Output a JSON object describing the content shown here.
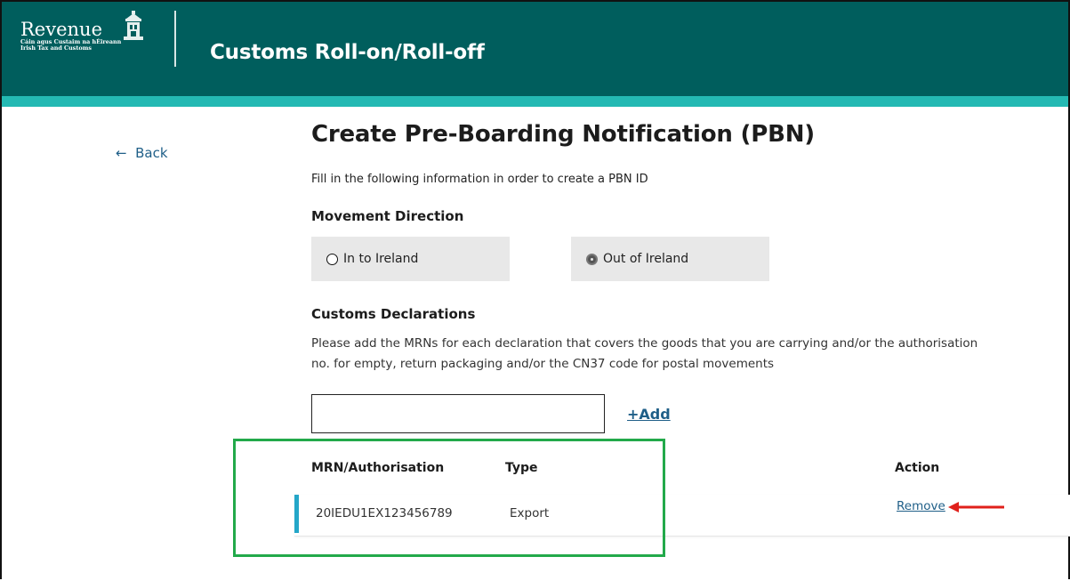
{
  "header": {
    "logo_word": "Revenue",
    "logo_line1": "Cáin agus Custaim na hÉireann",
    "logo_line2": "Irish Tax and Customs",
    "app_title": "Customs Roll-on/Roll-off"
  },
  "nav": {
    "back_icon": "arrow-left-icon",
    "back_label": "Back"
  },
  "page": {
    "title": "Create Pre-Boarding Notification (PBN)",
    "intro": "Fill in the following information in order to create a PBN ID"
  },
  "movement": {
    "heading": "Movement Direction",
    "options": [
      {
        "label": "In to Ireland",
        "selected": false
      },
      {
        "label": "Out of Ireland",
        "selected": true
      }
    ]
  },
  "declarations": {
    "heading": "Customs Declarations",
    "description": "Please add the MRNs for each declaration that covers the goods that you are carrying and/or the authorisation no. for empty, return packaging and/or the CN37 code for postal movements",
    "input_value": "",
    "add_label": "+Add",
    "columns": [
      "MRN/Authorisation",
      "Type",
      "Action"
    ],
    "rows": [
      {
        "mrn": "20IEDU1EX123456789",
        "type": "Export",
        "action": "Remove"
      }
    ]
  },
  "annotations": {
    "highlight_color": "#22a94a",
    "arrow_color": "#e0201b"
  },
  "colors": {
    "header_bg": "#005e5d",
    "accent_strip": "#24b9b3",
    "link": "#1f5f88"
  }
}
